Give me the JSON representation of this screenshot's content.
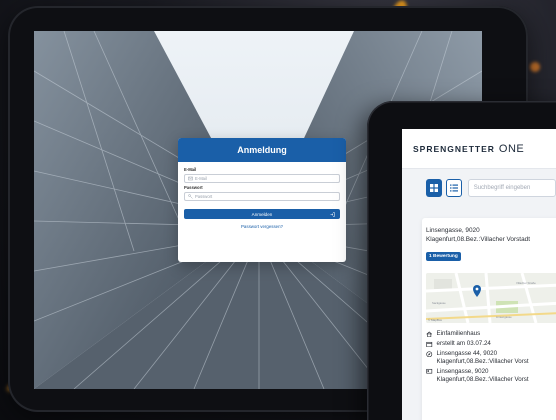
{
  "login": {
    "title": "Anmeldung",
    "email_label": "E-Mail",
    "email_placeholder": "E-Mail",
    "password_label": "Passwort",
    "password_placeholder": "Passwort",
    "submit_label": "Anmelden",
    "forgot_label": "Passwort vergessen?"
  },
  "app": {
    "brand": "SPRENGNETTER",
    "product": "ONE",
    "search_placeholder": "Suchbegriff eingeben",
    "property": {
      "address_line1": "Linsengasse, 9020",
      "address_line2": "Klagenfurt,08.Bez.:Villacher Vorstadt",
      "badge": "1 Bewertung",
      "map_attribution": "© MapBox",
      "map_labels": [
        "Villacher Straße",
        "Sackgasse",
        "Linsengasse"
      ],
      "type": "Einfamilienhaus",
      "created": "erstellt am 03.07.24",
      "addr2_line1": "Linsengasse 44, 9020",
      "addr2_line2": "Klagenfurt,08.Bez.:Villacher Vorst",
      "addr3_line1": "Linsengasse, 9020",
      "addr3_line2": "Klagenfurt,08.Bez.:Villacher Vorst"
    }
  },
  "colors": {
    "brand_blue": "#1a5fa8"
  }
}
